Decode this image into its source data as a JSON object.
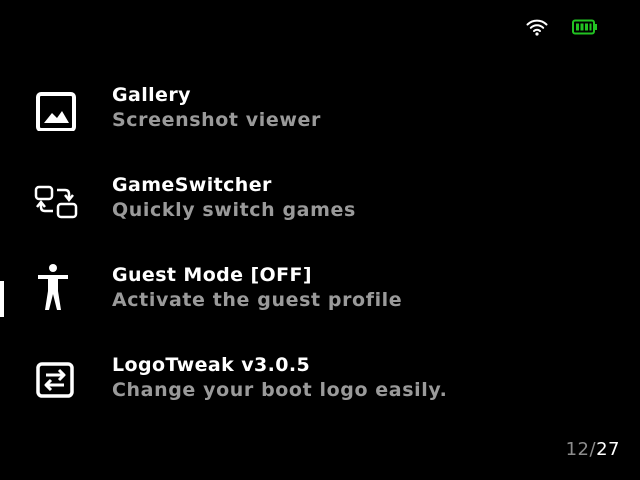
{
  "status": {
    "wifi_icon": "wifi-icon",
    "battery_icon": "battery-icon",
    "battery_color": "#22c322"
  },
  "menu": {
    "items": [
      {
        "icon": "image-icon",
        "title": "Gallery",
        "subtitle": "Screenshot viewer"
      },
      {
        "icon": "switch-windows-icon",
        "title": "GameSwitcher",
        "subtitle": "Quickly switch games"
      },
      {
        "icon": "accessibility-person-icon",
        "title": "Guest Mode [OFF]",
        "subtitle": "Activate the guest profile"
      },
      {
        "icon": "swap-arrows-icon",
        "title": "LogoTweak v3.0.5",
        "subtitle": "Change your boot logo easily.",
        "selected": true
      }
    ]
  },
  "pagination": {
    "current": "12",
    "separator": "/",
    "total": "27"
  }
}
